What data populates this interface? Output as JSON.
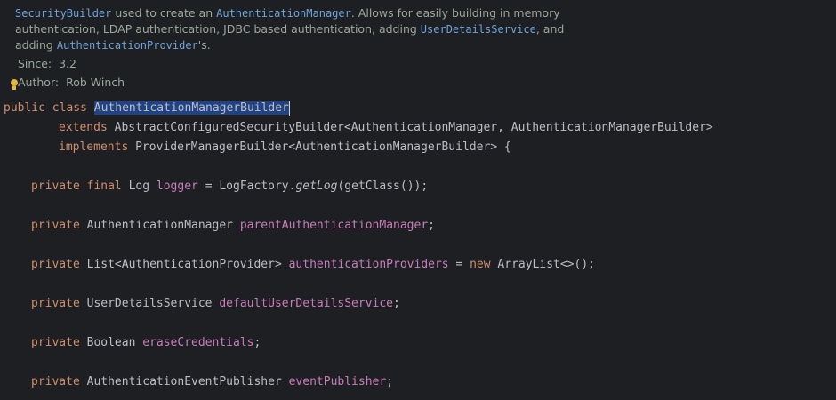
{
  "javadoc": {
    "ref_security_builder": "SecurityBuilder",
    "text_used_to": " used to create an ",
    "ref_authentication_manager": "AuthenticationManager",
    "text_allows": ". Allows for easily building in memory authentication, LDAP authentication, JDBC based authentication, adding ",
    "ref_user_details_service": "UserDetailsService",
    "text_and_adding": ", and adding ",
    "ref_authentication_provider": "AuthenticationProvider",
    "text_plural": "'s.",
    "since_label": "Since:",
    "since_value": "3.2",
    "author_label": "Author:",
    "author_value": "Rob Winch"
  },
  "code": {
    "l1_public": "public",
    "l1_class": "class",
    "l1_classname": "AuthenticationManagerBuilder",
    "l2_extends": "extends",
    "l2_type": "AbstractConfiguredSecurityBuilder<AuthenticationManager, AuthenticationManagerBuilder>",
    "l3_implements": "implements",
    "l3_type": "ProviderManagerBuilder<AuthenticationManagerBuilder> {",
    "f1_private": "private",
    "f1_final": "final",
    "f1_type": "Log",
    "f1_name": "logger",
    "f1_eq": " = LogFactory.",
    "f1_method": "getLog",
    "f1_rest": "(getClass());",
    "f2_private": "private",
    "f2_type": "AuthenticationManager",
    "f2_name": "parentAuthenticationManager",
    "f2_end": ";",
    "f3_private": "private",
    "f3_type": "List<AuthenticationProvider>",
    "f3_name": "authenticationProviders",
    "f3_eq": " = ",
    "f3_new": "new",
    "f3_rest": " ArrayList<>();",
    "f4_private": "private",
    "f4_type": "UserDetailsService",
    "f4_name": "defaultUserDetailsService",
    "f4_end": ";",
    "f5_private": "private",
    "f5_type": "Boolean",
    "f5_name": "eraseCredentials",
    "f5_end": ";",
    "f6_private": "private",
    "f6_type": "AuthenticationEventPublisher",
    "f6_name": "eventPublisher",
    "f6_end": ";"
  },
  "colors": {
    "background": "#1e1f22",
    "keyword": "#cf8e6d",
    "field": "#c77dbb",
    "doc_link": "#6ea3d8",
    "doc_text": "#9aa79a",
    "selection": "#214283"
  }
}
